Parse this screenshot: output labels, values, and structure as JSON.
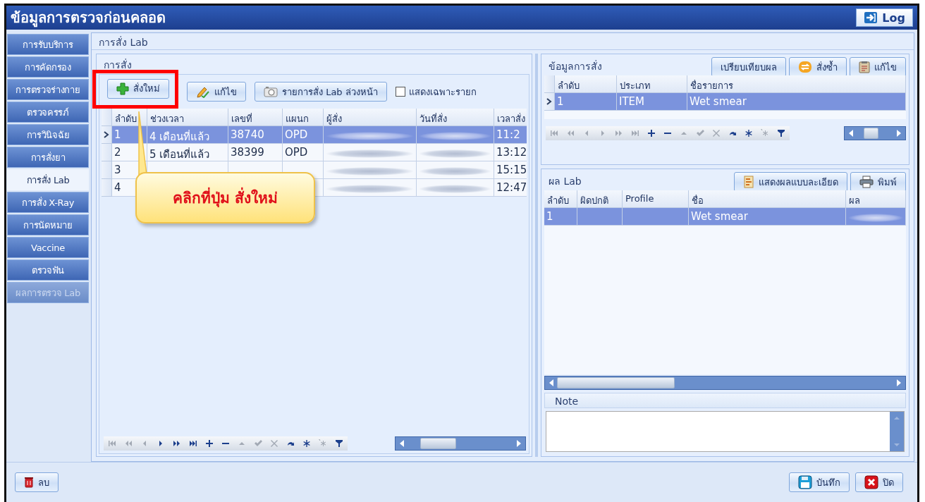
{
  "window": {
    "title": "ข้อมูลการตรวจก่อนคลอด",
    "log_button": "Log"
  },
  "sidebar": {
    "items": [
      {
        "label": "การรับบริการ",
        "selected": false,
        "disabled": false
      },
      {
        "label": "การคัดกรอง",
        "selected": false,
        "disabled": false
      },
      {
        "label": "การตรวจร่างกาย",
        "selected": false,
        "disabled": false
      },
      {
        "label": "ตรวจครรภ์",
        "selected": false,
        "disabled": false
      },
      {
        "label": "การวินิจฉัย",
        "selected": false,
        "disabled": false
      },
      {
        "label": "การสั่งยา",
        "selected": false,
        "disabled": false
      },
      {
        "label": "การสั่ง Lab",
        "selected": true,
        "disabled": false
      },
      {
        "label": "การสั่ง X-Ray",
        "selected": false,
        "disabled": false
      },
      {
        "label": "การนัดหมาย",
        "selected": false,
        "disabled": false
      },
      {
        "label": "Vaccine",
        "selected": false,
        "disabled": false
      },
      {
        "label": "ตรวจฟัน",
        "selected": false,
        "disabled": false
      },
      {
        "label": "ผลการตรวจ Lab",
        "selected": false,
        "disabled": true
      }
    ]
  },
  "panel": {
    "title": "การสั่ง Lab"
  },
  "orders": {
    "title": "การสั่ง",
    "toolbar": [
      {
        "label": "สั่งใหม่",
        "highlighted": true
      },
      {
        "label": "แก้ไข",
        "highlighted": false
      },
      {
        "label": "รายการสั่ง Lab ล่วงหน้า",
        "highlighted": false
      }
    ],
    "filter_checkbox": {
      "label": "แสดงเฉพาะรายก",
      "checked": false
    },
    "table": {
      "columns": [
        "ลำดับ",
        "ช่วงเวลา",
        "เลขที่",
        "แผนก",
        "ผู้สั่ง",
        "วันที่สั่ง",
        "เวลาสั่ง"
      ],
      "rows": [
        {
          "selected": true,
          "cells": [
            {
              "kind": "text",
              "text": "1"
            },
            {
              "kind": "text",
              "text": "4 เดือนที่แล้ว"
            },
            {
              "kind": "text",
              "text": "38740"
            },
            {
              "kind": "text",
              "text": "OPD"
            },
            {
              "kind": "blurred"
            },
            {
              "kind": "blurred"
            },
            {
              "kind": "text",
              "text": "11:2"
            }
          ]
        },
        {
          "selected": false,
          "cells": [
            {
              "kind": "text",
              "text": "2"
            },
            {
              "kind": "text",
              "text": "5 เดือนที่แล้ว"
            },
            {
              "kind": "text",
              "text": "38399"
            },
            {
              "kind": "text",
              "text": "OPD"
            },
            {
              "kind": "blurred"
            },
            {
              "kind": "blurred"
            },
            {
              "kind": "text",
              "text": "13:12"
            }
          ]
        },
        {
          "selected": false,
          "cells": [
            {
              "kind": "text",
              "text": "3"
            },
            {
              "kind": "empty"
            },
            {
              "kind": "empty"
            },
            {
              "kind": "empty"
            },
            {
              "kind": "blurred"
            },
            {
              "kind": "blurred"
            },
            {
              "kind": "text",
              "text": "15:15"
            }
          ]
        },
        {
          "selected": false,
          "cells": [
            {
              "kind": "text",
              "text": "4"
            },
            {
              "kind": "empty"
            },
            {
              "kind": "empty"
            },
            {
              "kind": "empty"
            },
            {
              "kind": "blurred"
            },
            {
              "kind": "blurred"
            },
            {
              "kind": "text",
              "text": "12:47"
            }
          ]
        }
      ]
    },
    "navigator": [
      {
        "disabled": true
      },
      {
        "disabled": true
      },
      {
        "disabled": true
      },
      {
        "disabled": false
      },
      {
        "disabled": false
      },
      {
        "disabled": false
      },
      {
        "disabled": false
      },
      {
        "disabled": false
      },
      {
        "disabled": true
      },
      {
        "disabled": true
      },
      {
        "disabled": true
      },
      {
        "disabled": false
      },
      {
        "disabled": false
      },
      {
        "disabled": true
      },
      {
        "disabled": false
      }
    ]
  },
  "callout": {
    "text": "คลิกที่ปุ่ม สั่งใหม่"
  },
  "order_detail": {
    "title": "ข้อมูลการสั่ง",
    "buttons": [
      "เปรียบเทียบผล",
      "สั่งซ้ำ",
      "แก้ไข"
    ],
    "table": {
      "columns": [
        "ลำดับ",
        "ประเภท",
        "ชื่อรายการ"
      ],
      "rows": [
        {
          "selected": true,
          "cells": [
            {
              "kind": "text",
              "text": "1"
            },
            {
              "kind": "text",
              "text": "ITEM"
            },
            {
              "kind": "text",
              "text": "Wet smear"
            }
          ]
        }
      ]
    },
    "navigator": [
      {
        "disabled": true
      },
      {
        "disabled": true
      },
      {
        "disabled": true
      },
      {
        "disabled": true
      },
      {
        "disabled": true
      },
      {
        "disabled": true
      },
      {
        "disabled": false
      },
      {
        "disabled": false
      },
      {
        "disabled": true
      },
      {
        "disabled": true
      },
      {
        "disabled": true
      },
      {
        "disabled": false
      },
      {
        "disabled": false
      },
      {
        "disabled": true
      },
      {
        "disabled": false
      }
    ]
  },
  "lab_result": {
    "title": "ผล Lab",
    "buttons": [
      "แสดงผลแบบละเอียด",
      "พิมพ์"
    ],
    "table": {
      "columns": [
        "ลำดับ",
        "ผิดปกติ",
        "Profile",
        "ชื่อ",
        "ผล"
      ],
      "rows": [
        {
          "selected": true,
          "cells": [
            {
              "kind": "text",
              "text": "1"
            },
            {
              "kind": "empty"
            },
            {
              "kind": "empty"
            },
            {
              "kind": "text",
              "text": "Wet smear"
            },
            {
              "kind": "blurred"
            }
          ]
        }
      ]
    }
  },
  "note": {
    "label": "Note"
  },
  "footer": {
    "delete_button": "ลบ",
    "save_button": "บันทึก",
    "close_button": "ปิด"
  }
}
